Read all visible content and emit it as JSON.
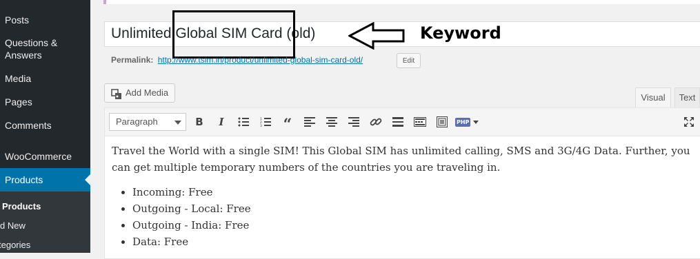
{
  "sidebar": {
    "items": [
      {
        "label": "Posts"
      },
      {
        "label": "Questions & Answers"
      },
      {
        "label": "Media"
      },
      {
        "label": "Pages"
      },
      {
        "label": "Comments"
      },
      {
        "label": "WooCommerce"
      },
      {
        "label": "Products"
      }
    ],
    "submenu": [
      {
        "label": "Products"
      },
      {
        "label": "d New"
      },
      {
        "label": "tegories"
      }
    ]
  },
  "title": {
    "value": "Unlimited Global SIM Card (old)",
    "highlight_label": "Keyword"
  },
  "permalink": {
    "label": "Permalink:",
    "url": "http://www.tsim.in/product/unlimited-global-sim-card-old/",
    "edit_label": "Edit"
  },
  "media": {
    "add_label": "Add Media"
  },
  "tabs": [
    {
      "label": "Visual"
    },
    {
      "label": "Text"
    }
  ],
  "toolbar": {
    "format_value": "Paragraph",
    "buttons": [
      "bold-icon",
      "italic-icon",
      "bullet-list-icon",
      "numbered-list-icon",
      "blockquote-icon",
      "align-left-icon",
      "align-center-icon",
      "align-right-icon",
      "link-icon",
      "horizontal-rule-icon",
      "toolbar-toggle-icon",
      "insert-table-icon",
      "php-icon",
      "fullscreen-icon"
    ],
    "php_label": "PHP"
  },
  "content": {
    "paragraph": "Travel the World with a single SIM! This Global SIM has unlimited calling, SMS and 3G/4G Data. Further, you can get multiple temporary numbers of the countries you are traveling in.",
    "list": [
      {
        "text": "Incoming: Free"
      },
      {
        "text": "Outgoing - Local: Free"
      },
      {
        "text": "Outgoing - India: Free"
      },
      {
        "text": "Data: Free"
      }
    ]
  },
  "colors": {
    "sidebar_bg": "#23282d",
    "active_bg": "#0073aa",
    "link": "#0073aa",
    "annotation": "#000000"
  }
}
